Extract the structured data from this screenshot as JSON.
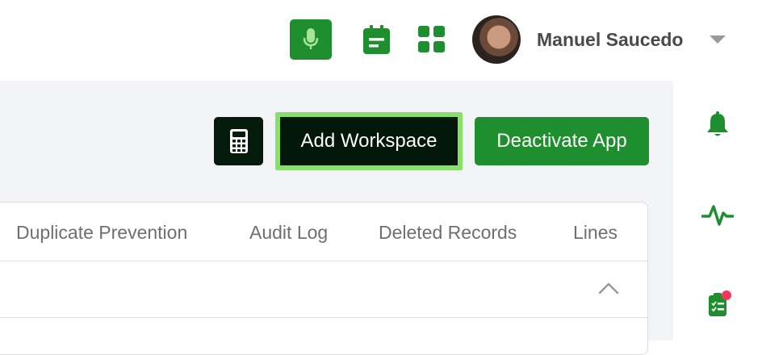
{
  "header": {
    "user_name": "Manuel Saucedo",
    "icons": [
      "microphone-icon",
      "calendar-icon",
      "apps-grid-icon",
      "chevron-down-icon"
    ]
  },
  "toolbar": {
    "add_workspace_label": "Add Workspace",
    "deactivate_label": "Deactivate App"
  },
  "tabs": [
    {
      "label": "Duplicate Prevention"
    },
    {
      "label": "Audit Log"
    },
    {
      "label": "Deleted Records"
    },
    {
      "label": "Lines"
    }
  ],
  "right_sidebar": {
    "icons": [
      "bell-icon",
      "activity-pulse-icon",
      "clipboard-checklist-icon"
    ],
    "notification_dot": true
  },
  "colors": {
    "brand_green": "#1e8e2e",
    "focus_ring": "#86e06a",
    "dark_button": "#041a0b",
    "notification_red": "#f0395a",
    "panel_bg": "#f3f4f8"
  }
}
